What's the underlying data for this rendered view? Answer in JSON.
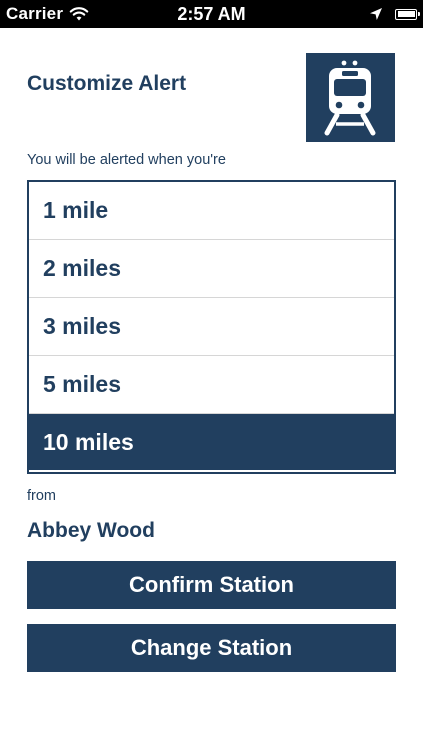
{
  "status_bar": {
    "carrier": "Carrier",
    "time": "2:57 AM",
    "icons": [
      "wifi-icon",
      "location-arrow-icon",
      "battery-icon"
    ]
  },
  "header": {
    "title": "Customize Alert",
    "logo_icon": "train-icon"
  },
  "prompt": "You will be alerted when you're",
  "distance_options": [
    {
      "label": "1 mile",
      "selected": false
    },
    {
      "label": "2 miles",
      "selected": false
    },
    {
      "label": "3 miles",
      "selected": false
    },
    {
      "label": "5 miles",
      "selected": false
    },
    {
      "label": "10 miles",
      "selected": true
    }
  ],
  "from_label": "from",
  "station": "Abbey Wood",
  "buttons": {
    "confirm": "Confirm Station",
    "change": "Change Station"
  },
  "colors": {
    "primary": "#213f5f",
    "background": "#ffffff",
    "status_bar": "#000000",
    "divider": "#d6d6d6"
  }
}
